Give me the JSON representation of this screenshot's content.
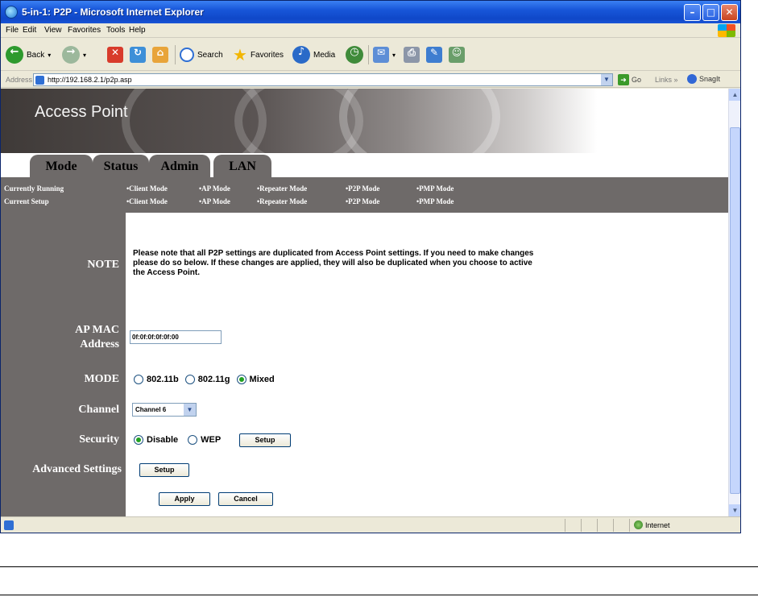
{
  "window": {
    "title": "5-in-1: P2P - Microsoft Internet Explorer"
  },
  "menu": [
    "File",
    "Edit",
    "View",
    "Favorites",
    "Tools",
    "Help"
  ],
  "toolbar": {
    "back": "Back",
    "search": "Search",
    "favorites": "Favorites",
    "media": "Media"
  },
  "address": {
    "label": "Address",
    "url": "http://192.168.2.1/p2p.asp",
    "go": "Go",
    "links": "Links",
    "snagit": "SnagIt"
  },
  "banner": {
    "title": "Access Point"
  },
  "tabs": [
    "Mode",
    "Status",
    "Admin",
    "LAN"
  ],
  "mode_strip": {
    "running_label": "Currently Running",
    "setup_label": "Current Setup",
    "modes": [
      "•Client Mode",
      "•AP Mode",
      "•Repeater Mode",
      "•P2P Mode",
      "•PMP Mode"
    ]
  },
  "form": {
    "note_label": "NOTE",
    "note_text": "Please note that all P2P settings are duplicated from Access Point settings. If you need to make changes please do so below. If these changes are applied, they will also be duplicated when you choose to active the Access Point.",
    "mac_label_1": "AP MAC",
    "mac_label_2": "Address",
    "mac_value": "0f:0f:0f:0f:0f:00",
    "mode_label": "MODE",
    "mode_options": [
      "802.11b",
      "802.11g",
      "Mixed"
    ],
    "mode_selected": "Mixed",
    "channel_label": "Channel",
    "channel_value": "Channel 6",
    "security_label": "Security",
    "security_options": [
      "Disable",
      "WEP"
    ],
    "security_selected": "Disable",
    "security_setup": "Setup",
    "advanced_label": "Advanced Settings",
    "advanced_setup": "Setup",
    "apply": "Apply",
    "cancel": "Cancel"
  },
  "status": {
    "zone": "Internet"
  },
  "colors": {
    "panel": "#6e6a69",
    "titlebar": "#0f47c8"
  }
}
